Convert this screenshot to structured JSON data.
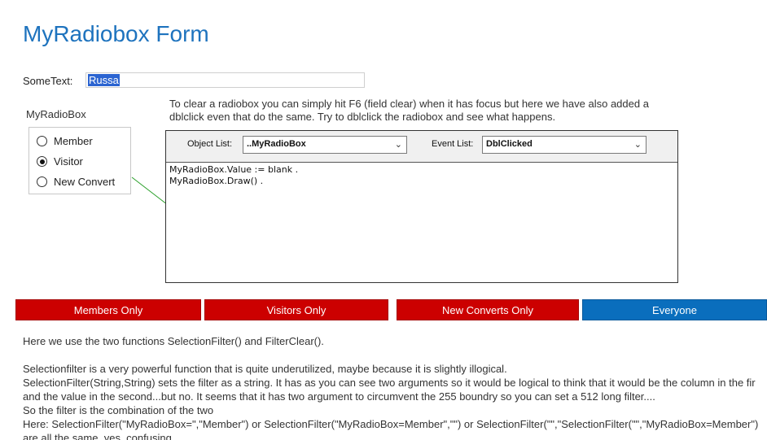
{
  "page": {
    "title": "MyRadiobox Form"
  },
  "sometext": {
    "label": "SomeText:",
    "value": "Russa"
  },
  "radio_group": {
    "label": "MyRadioBox",
    "options": [
      {
        "label": "Member",
        "checked": false
      },
      {
        "label": "Visitor",
        "checked": true
      },
      {
        "label": "New Convert",
        "checked": false
      }
    ]
  },
  "info": {
    "text": "To clear a radiobox you can simply hit F6 (field clear) when it has focus but here we have also added a dblclick even that do the same. Try to dblclick the radiobox and see what happens."
  },
  "code_panel": {
    "object_list_label": "Object List:",
    "object_list_value": "..MyRadioBox",
    "event_list_label": "Event List:",
    "event_list_value": "DblClicked",
    "code_lines": [
      "MyRadioBox.Value := blank .",
      "MyRadioBox.Draw() ."
    ]
  },
  "buttons": {
    "members_only": "Members Only",
    "visitors_only": "Visitors Only",
    "new_converts_only": "New Converts Only",
    "everyone": "Everyone"
  },
  "body": {
    "lines": [
      "Here we use the two functions SelectionFilter() and FilterClear().",
      "",
      "Selectionfilter is a very powerful function that is quite underutilized, maybe because it is slightly illogical.",
      "SelectionFilter(String,String) sets the filter as a string. It has as you can see two arguments so it would be logical to think that it would be the column in the fir",
      "and the value in the second...but no. It seems that it has two argument to circumvent the 255 boundry so you can set a 512 long filter....",
      "So the filter is the combination of the two",
      "Here: SelectionFilter(\"MyRadioBox=\",\"Member\") or SelectionFilter(\"MyRadioBox=Member\",\"\") or SelectionFilter(\"\",\"SelectionFilter(\"\",\"MyRadioBox=Member\")",
      "are all the same, yes, confusing."
    ]
  },
  "colors": {
    "title": "#1e73be",
    "button_red": "#cc0000",
    "button_blue": "#0a6ebd",
    "selection": "#2b64d1",
    "connector": "#2ca02c"
  }
}
